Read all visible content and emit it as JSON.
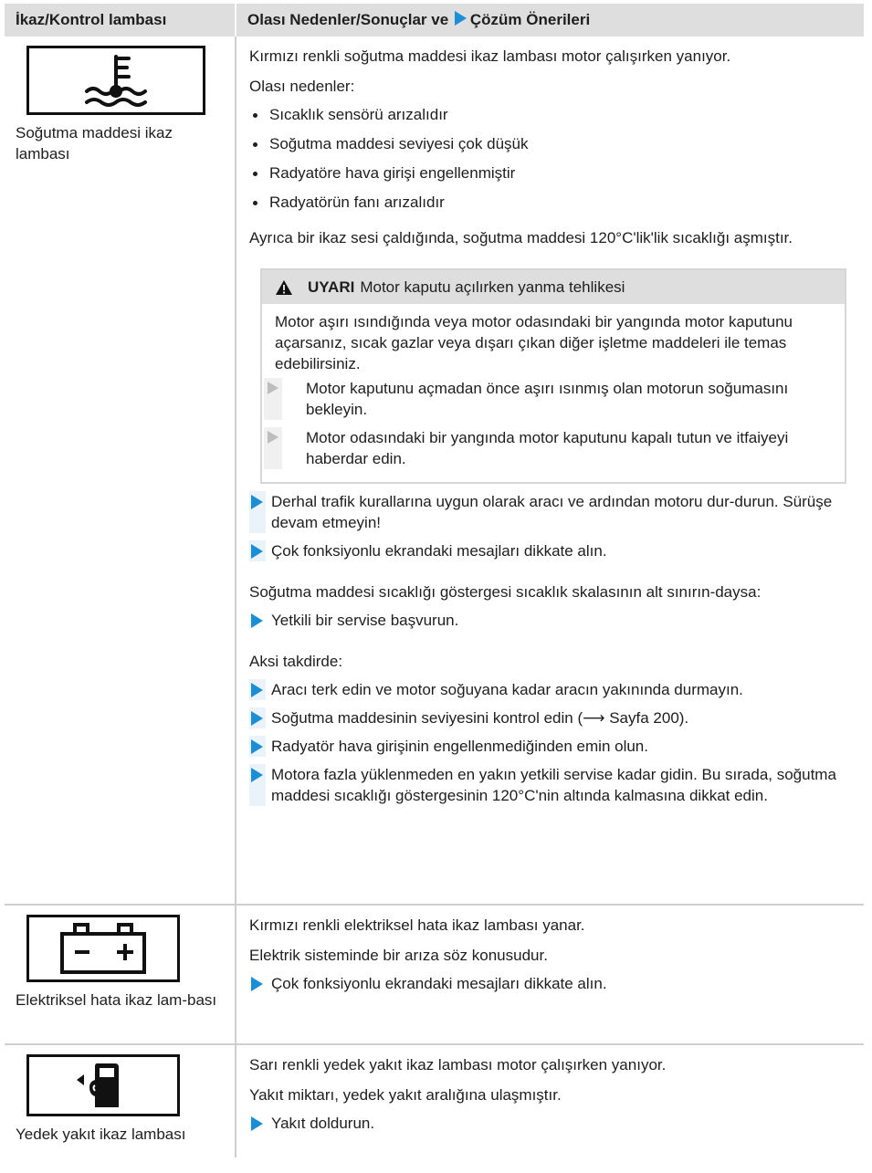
{
  "header": {
    "col1": "İkaz/Kontrol lambası",
    "col2_a": "Olası Nedenler/Sonuçlar ve",
    "col2_b": "Çözüm Önerileri"
  },
  "rows": {
    "coolant": {
      "icon": "coolant-temperature-icon",
      "caption": "Soğutma maddesi ikaz lambası",
      "intro": "Kırmızı renkli soğutma maddesi ikaz lambası motor çalışırken yanıyor.",
      "causes_title": "Olası nedenler:",
      "causes": [
        "Sıcaklık sensörü arızalıdır",
        "Soğutma maddesi seviyesi çok düşük",
        "Radyatöre hava girişi engellenmiştir",
        "Radyatörün fanı arızalıdır"
      ],
      "note": "Ayrıca bir ikaz sesi çaldığında, soğutma maddesi 120°C'lik'lik sıcaklığı aşmıştır.",
      "warning": {
        "label": "UYARI",
        "title": "Motor kaputu açılırken yanma tehlikesi",
        "text": "Motor aşırı ısındığında veya motor odasındaki bir yangında motor kaputunu açarsanız, sıcak gazlar veya dışarı çıkan diğer işletme maddeleri ile temas edebilirsiniz.",
        "steps": [
          "Motor kaputunu açmadan önce aşırı ısınmış olan motorun soğumasını bekleyin.",
          "Motor odasındaki bir yangında motor kaputunu kapalı tutun ve itfaiyeyi haberdar edin."
        ]
      },
      "steps1": [
        "Derhal trafik kurallarına uygun olarak aracı ve ardından motoru dur-durun. Sürüşe devam etmeyin!",
        "Çok fonksiyonlu ekrandaki mesajları dikkate alın."
      ],
      "low_text": "Soğutma maddesi sıcaklığı göstergesi sıcaklık skalasının alt sınırın-daysa:",
      "steps2": [
        "Yetkili bir servise başvurun."
      ],
      "else_text": "Aksi takdirde:",
      "steps3": [
        "Aracı terk edin ve motor soğuyana kadar aracın yakınında durmayın.",
        "Soğutma maddesinin seviyesini kontrol edin (⟶ Sayfa 200).",
        "Radyatör hava girişinin engellenmediğinden emin olun.",
        "Motora fazla yüklenmeden en yakın yetkili servise kadar gidin. Bu sırada, soğutma maddesi sıcaklığı göstergesinin 120°C'nin altında kalmasına dikkat edin."
      ]
    },
    "electrical": {
      "icon": "battery-icon",
      "caption": "Elektriksel hata ikaz lam-bası",
      "line1": "Kırmızı renkli elektriksel hata ikaz lambası yanar.",
      "line2": "Elektrik sisteminde bir arıza söz konusudur.",
      "step": "Çok fonksiyonlu ekrandaki mesajları dikkate alın."
    },
    "fuel": {
      "icon": "fuel-pump-icon",
      "caption": "Yedek yakıt ikaz lambası",
      "line1": "Sarı renkli yedek yakıt ikaz lambası motor çalışırken yanıyor.",
      "line2": "Yakıt miktarı, yedek yakıt aralığına ulaşmıştır.",
      "step": "Yakıt doldurun."
    }
  },
  "colors": {
    "accent": "#1a8fd6",
    "header_bg": "#dedede",
    "border": "#cfcfcf"
  }
}
